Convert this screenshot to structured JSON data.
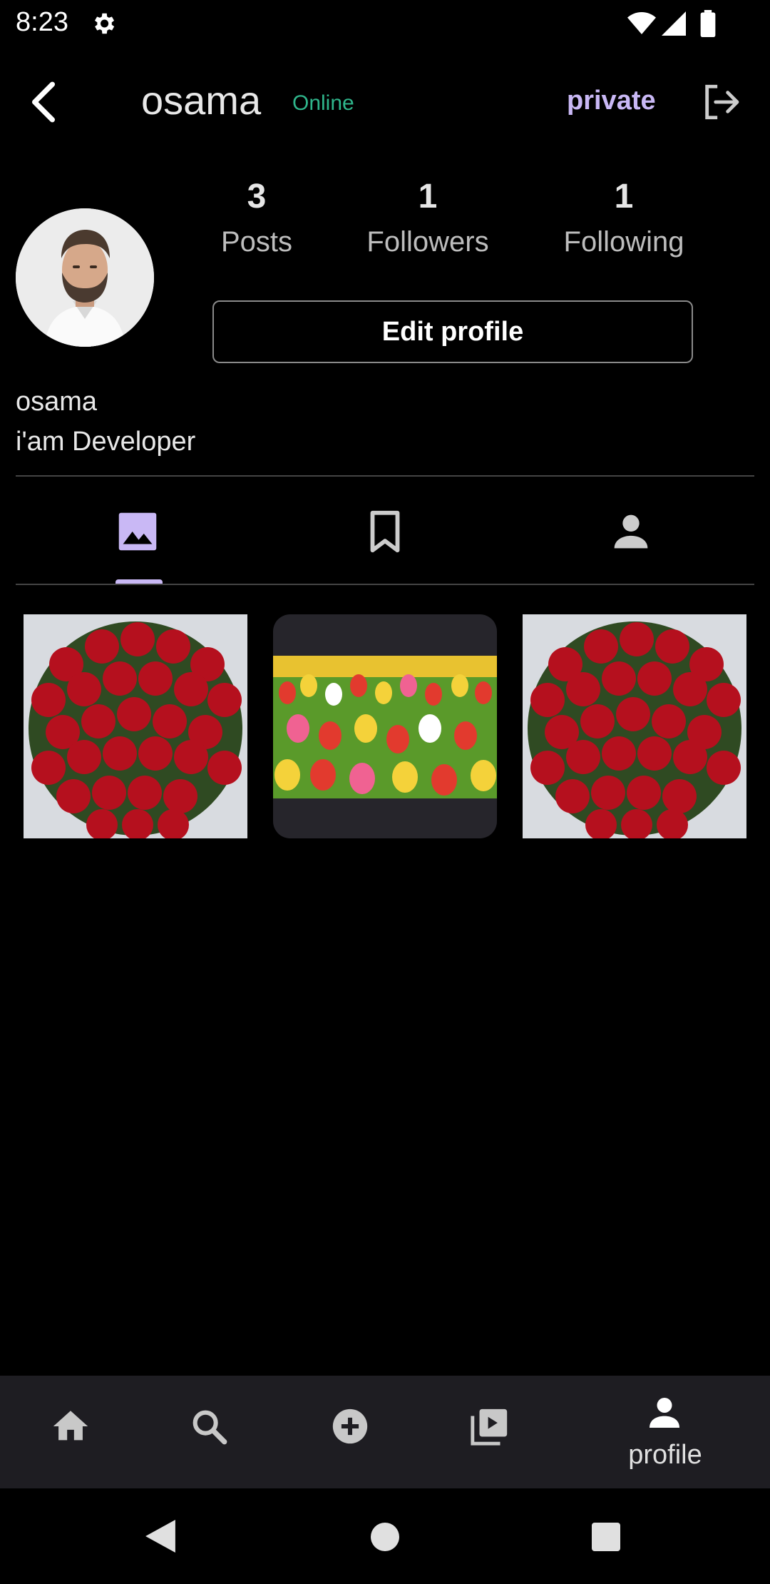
{
  "status_bar": {
    "time": "8:23"
  },
  "header": {
    "username": "osama",
    "online_status": "Online",
    "privacy": "private"
  },
  "stats": {
    "posts": {
      "value": "3",
      "label": "Posts"
    },
    "followers": {
      "value": "1",
      "label": "Followers"
    },
    "following": {
      "value": "1",
      "label": "Following"
    }
  },
  "profile": {
    "edit_button": "Edit profile",
    "display_name": "osama",
    "bio": "i'am Developer"
  },
  "tabs": [
    {
      "icon": "image-icon",
      "active": true
    },
    {
      "icon": "bookmark-icon",
      "active": false
    },
    {
      "icon": "person-icon",
      "active": false
    }
  ],
  "posts": [
    {
      "image": "red-roses-bouquet"
    },
    {
      "image": "tulip-field"
    },
    {
      "image": "red-roses-bouquet"
    }
  ],
  "bottom_nav": {
    "items": [
      "home-icon",
      "search-icon",
      "add-circle-icon",
      "video-library-icon",
      "person-icon"
    ],
    "active_label": "profile"
  },
  "colors": {
    "accent": "#c9b8f5",
    "online": "#2fb58b",
    "nav_background": "#1e1d22"
  }
}
